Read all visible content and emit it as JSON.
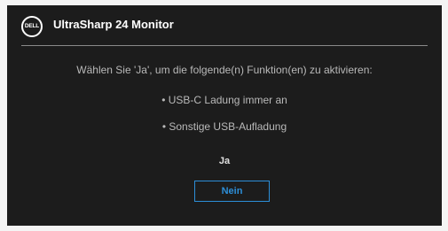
{
  "header": {
    "logo_text": "DELL",
    "title": "UltraSharp 24 Monitor"
  },
  "dialog": {
    "message": "Wählen Sie 'Ja', um die folgende(n) Funktion(en) zu aktivieren:",
    "options": [
      "• USB-C Ladung immer an",
      "• Sonstige USB-Aufladung"
    ],
    "yes_label": "Ja",
    "no_label": "Nein",
    "selected": "Nein"
  },
  "colors": {
    "background": "#1c1c1c",
    "accent": "#2c8ed8",
    "text": "#b9b9b9"
  }
}
